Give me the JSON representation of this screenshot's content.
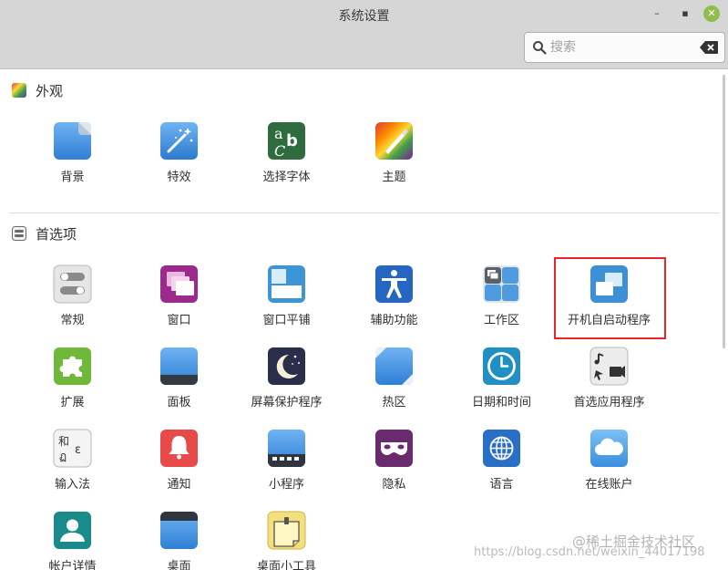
{
  "window": {
    "title": "系统设置",
    "minimize_glyph": "–",
    "maximize_glyph": "▪",
    "close_glyph": "✕"
  },
  "search": {
    "placeholder": "搜索",
    "value": ""
  },
  "sections": {
    "appearance": {
      "title": "外观"
    },
    "preferences": {
      "title": "首选项"
    }
  },
  "items": {
    "background": "背景",
    "effects": "特效",
    "fonts": "选择字体",
    "themes": "主题",
    "general": "常规",
    "windows": "窗口",
    "window_tiling": "窗口平铺",
    "accessibility": "辅助功能",
    "workspaces": "工作区",
    "startup_apps": "开机自启动程序",
    "extensions": "扩展",
    "panel": "面板",
    "screensaver": "屏幕保护程序",
    "hot_corners": "热区",
    "date_time": "日期和时间",
    "preferred_apps": "首选应用程序",
    "input_method": "输入法",
    "notifications": "通知",
    "applets": "小程序",
    "privacy": "隐私",
    "languages": "语言",
    "online_accounts": "在线账户",
    "account_details": "帐户详情",
    "desktop": "桌面",
    "desklets": "桌面小工具"
  },
  "icon_glyphs": {
    "fonts_a": "a",
    "fonts_b": "b",
    "fonts_c": "C",
    "input_method_top": "和",
    "input_method_bottom": "ฏ",
    "input_method_side": "ε"
  },
  "watermark": {
    "top": "@稀土掘金技术社区",
    "bottom": "https://blog.csdn.net/weixin_44017198"
  },
  "colors": {
    "titlebar": "#d6d6d6",
    "highlight": "#e8262a",
    "close_button": "#8fbe4f"
  }
}
